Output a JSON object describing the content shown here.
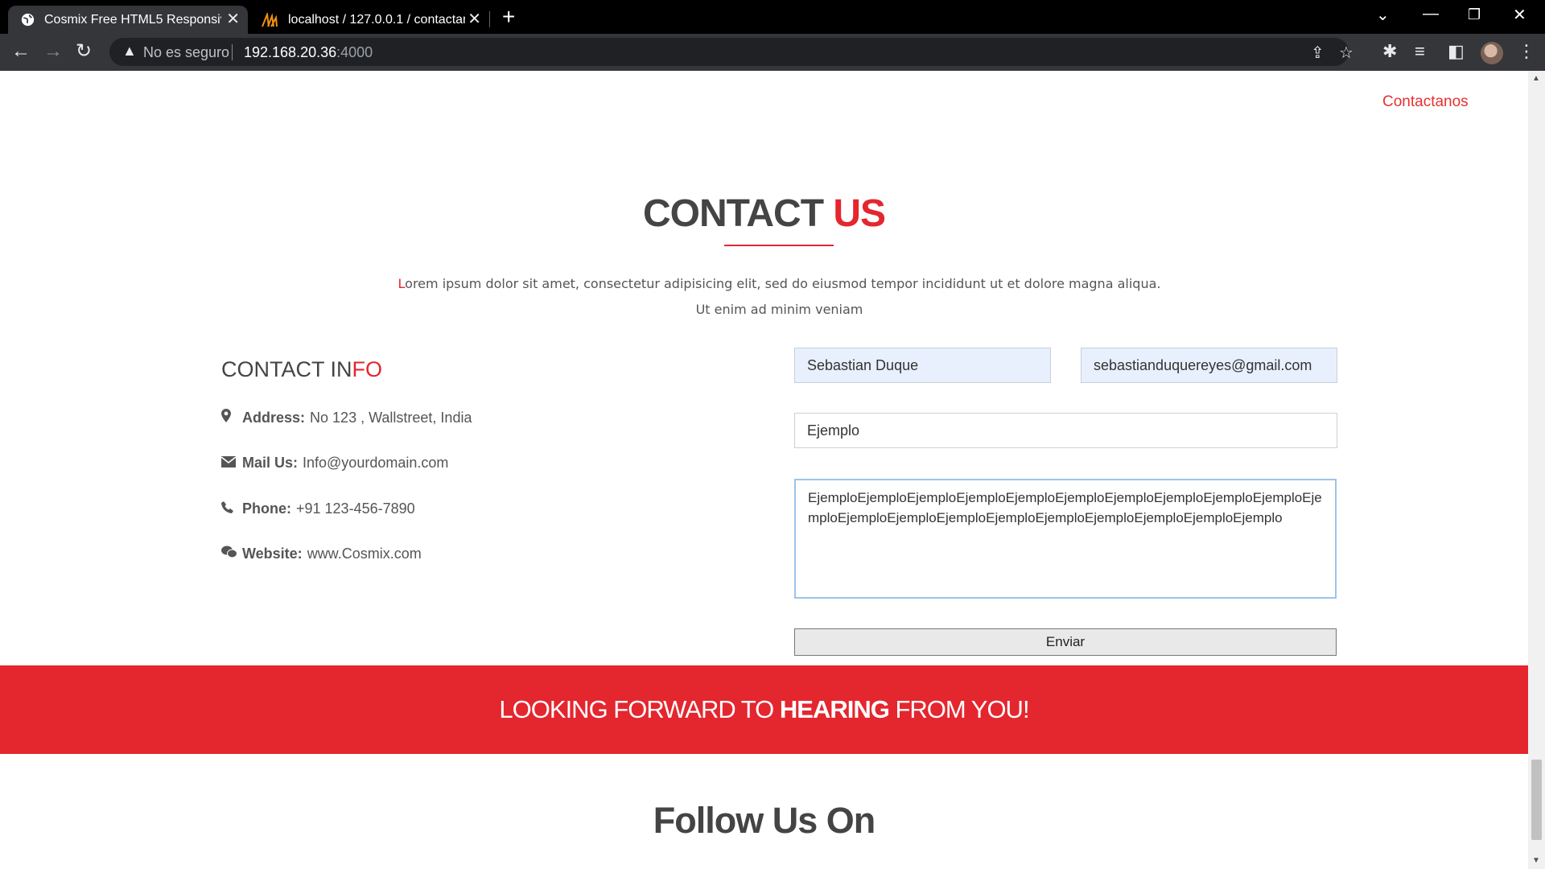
{
  "browser": {
    "tabs": [
      {
        "title": "Cosmix Free HTML5 Responsive T",
        "active": true
      },
      {
        "title": "localhost / 127.0.0.1 / contactam",
        "active": false
      }
    ],
    "security_label": "No es seguro",
    "url_host": "192.168.20.36",
    "url_port": ":4000"
  },
  "nav": {
    "contact_link": "Contactanos"
  },
  "contact": {
    "title_main": "CONTACT ",
    "title_accent": "US",
    "lead_first_letter": "L",
    "lead_rest": "orem ipsum dolor sit amet, consectetur adipisicing elit, sed do eiusmod tempor incididunt ut et dolore magna aliqua.",
    "lead_line2": "Ut enim ad minim veniam"
  },
  "info": {
    "heading_main": "CONTACT IN",
    "heading_accent": "FO",
    "rows": [
      {
        "icon": "map-marker-icon",
        "label": "Address:",
        "value": "No 123 , Wallstreet, India"
      },
      {
        "icon": "envelope-icon",
        "label": "Mail Us:",
        "value": "Info@yourdomain.com"
      },
      {
        "icon": "phone-icon",
        "label": "Phone:",
        "value": "+91 123-456-7890"
      },
      {
        "icon": "wechat-icon",
        "label": "Website:",
        "value": "www.Cosmix.com"
      }
    ]
  },
  "form": {
    "name_value": "Sebastian Duque",
    "email_value": "sebastianduquereyes@gmail.com",
    "subject_value": "Ejemplo",
    "message_value": "EjemploEjemploEjemploEjemploEjemploEjemploEjemploEjemploEjemploEjemploEjemploEjemploEjemploEjemploEjemploEjemploEjemploEjemploEjemploEjemplo",
    "submit_label": "Enviar"
  },
  "banner": {
    "part1": "LOOKING FORWARD TO ",
    "strong": "HEARING",
    "part2": " FROM YOU!"
  },
  "follow": {
    "title": "Follow Us On"
  },
  "colors": {
    "accent": "#e4262f",
    "text": "#444444"
  }
}
